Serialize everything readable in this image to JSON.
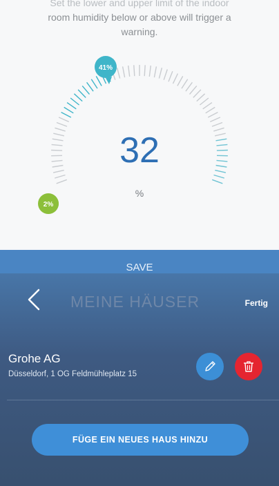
{
  "humidity_setting": {
    "description_line_cut": "Set the lower and upper limit of the indoor",
    "description_line_2": "room humidity below or above will trigger a",
    "description_line_3": "warning.",
    "current_value": "32",
    "unit": "%",
    "upper_limit_label": "41%",
    "lower_limit_label": "2%",
    "upper_limit_value": 41,
    "lower_limit_value": 2,
    "colors": {
      "upper_marker": "#3fb5c9",
      "lower_marker": "#8cbf3a",
      "value_text": "#2e6fb4",
      "ticks": "#c9ccd0"
    },
    "save_label": "SAVE"
  },
  "houses_screen": {
    "back_icon": "chevron-left-icon",
    "title": "MEINE HÄUSER",
    "done_label": "Fertig",
    "houses": [
      {
        "name": "Grohe AG",
        "address": "Düsseldorf, 1 OG Feldmühleplatz 15",
        "edit_icon": "pencil-icon",
        "delete_icon": "trash-icon"
      }
    ],
    "add_house_label": "FÜGE EIN NEUES HAUS HINZU",
    "colors": {
      "edit": "#3c8fd6",
      "delete": "#e52530",
      "add_button": "#3f8fd8"
    }
  }
}
